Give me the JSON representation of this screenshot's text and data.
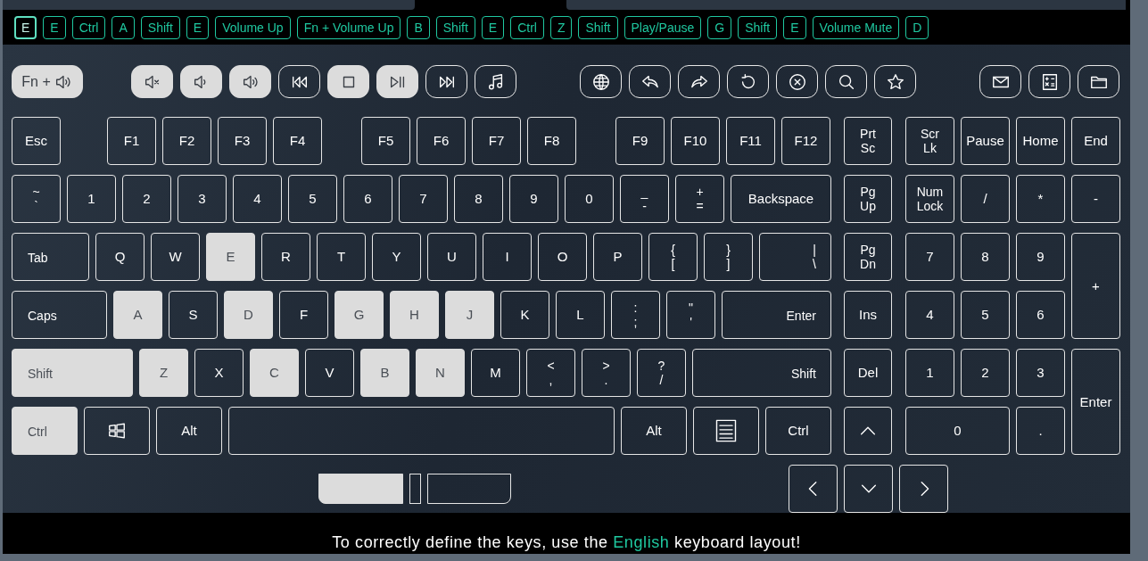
{
  "key_history": [
    {
      "label": "E",
      "selected": true
    },
    {
      "label": "E",
      "selected": false
    },
    {
      "label": "Ctrl",
      "selected": false
    },
    {
      "label": "A",
      "selected": false
    },
    {
      "label": "Shift",
      "selected": false
    },
    {
      "label": "E",
      "selected": false
    },
    {
      "label": "Volume Up",
      "selected": false
    },
    {
      "label": "Fn + Volume Up",
      "selected": false
    },
    {
      "label": "B",
      "selected": false
    },
    {
      "label": "Shift",
      "selected": false
    },
    {
      "label": "E",
      "selected": false
    },
    {
      "label": "Ctrl",
      "selected": false
    },
    {
      "label": "Z",
      "selected": false
    },
    {
      "label": "Shift",
      "selected": false
    },
    {
      "label": "Play/Pause",
      "selected": false
    },
    {
      "label": "G",
      "selected": false
    },
    {
      "label": "Shift",
      "selected": false
    },
    {
      "label": "E",
      "selected": false
    },
    {
      "label": "Volume Mute",
      "selected": false
    },
    {
      "label": "D",
      "selected": false
    }
  ],
  "media_keys": [
    {
      "kind": "fn-volume",
      "label": "Fn +",
      "pressed": true
    },
    {
      "kind": "mute",
      "pressed": true
    },
    {
      "kind": "volume-down",
      "pressed": true
    },
    {
      "kind": "volume-up",
      "pressed": true
    },
    {
      "kind": "previous",
      "pressed": false
    },
    {
      "kind": "stop",
      "pressed": true
    },
    {
      "kind": "play-pause",
      "pressed": true
    },
    {
      "kind": "next",
      "pressed": false
    },
    {
      "kind": "music",
      "pressed": false
    },
    {
      "kind": "globe",
      "pressed": false
    },
    {
      "kind": "back",
      "pressed": false
    },
    {
      "kind": "forward",
      "pressed": false
    },
    {
      "kind": "refresh",
      "pressed": false
    },
    {
      "kind": "cancel",
      "pressed": false
    },
    {
      "kind": "search",
      "pressed": false
    },
    {
      "kind": "star",
      "pressed": false
    },
    {
      "kind": "mail",
      "pressed": false
    },
    {
      "kind": "calculator",
      "pressed": false
    },
    {
      "kind": "folder",
      "pressed": false
    }
  ],
  "main_rows": [
    [
      {
        "lines": [
          "Esc"
        ],
        "pressed": false
      },
      {
        "lines": [
          "F1"
        ],
        "pressed": false
      },
      {
        "lines": [
          "F2"
        ],
        "pressed": false
      },
      {
        "lines": [
          "F3"
        ],
        "pressed": false
      },
      {
        "lines": [
          "F4"
        ],
        "pressed": false
      },
      {
        "lines": [
          "F5"
        ],
        "pressed": false
      },
      {
        "lines": [
          "F6"
        ],
        "pressed": false
      },
      {
        "lines": [
          "F7"
        ],
        "pressed": false
      },
      {
        "lines": [
          "F8"
        ],
        "pressed": false
      },
      {
        "lines": [
          "F9"
        ],
        "pressed": false
      },
      {
        "lines": [
          "F10"
        ],
        "pressed": false
      },
      {
        "lines": [
          "F11"
        ],
        "pressed": false
      },
      {
        "lines": [
          "F12"
        ],
        "pressed": false
      }
    ],
    [
      {
        "lines": [
          "~",
          "`"
        ],
        "pressed": false
      },
      {
        "lines": [
          "1"
        ],
        "pressed": false
      },
      {
        "lines": [
          "2"
        ],
        "pressed": false
      },
      {
        "lines": [
          "3"
        ],
        "pressed": false
      },
      {
        "lines": [
          "4"
        ],
        "pressed": false
      },
      {
        "lines": [
          "5"
        ],
        "pressed": false
      },
      {
        "lines": [
          "6"
        ],
        "pressed": false
      },
      {
        "lines": [
          "7"
        ],
        "pressed": false
      },
      {
        "lines": [
          "8"
        ],
        "pressed": false
      },
      {
        "lines": [
          "9"
        ],
        "pressed": false
      },
      {
        "lines": [
          "0"
        ],
        "pressed": false
      },
      {
        "lines": [
          "_",
          "-"
        ],
        "pressed": false
      },
      {
        "lines": [
          "+",
          "="
        ],
        "pressed": false
      },
      {
        "lines": [
          "Backspace"
        ],
        "pressed": false
      }
    ],
    [
      {
        "lines": [
          "Tab"
        ],
        "pressed": false
      },
      {
        "lines": [
          "Q"
        ],
        "pressed": false
      },
      {
        "lines": [
          "W"
        ],
        "pressed": false
      },
      {
        "lines": [
          "E"
        ],
        "pressed": true
      },
      {
        "lines": [
          "R"
        ],
        "pressed": false
      },
      {
        "lines": [
          "T"
        ],
        "pressed": false
      },
      {
        "lines": [
          "Y"
        ],
        "pressed": false
      },
      {
        "lines": [
          "U"
        ],
        "pressed": false
      },
      {
        "lines": [
          "I"
        ],
        "pressed": false
      },
      {
        "lines": [
          "O"
        ],
        "pressed": false
      },
      {
        "lines": [
          "P"
        ],
        "pressed": false
      },
      {
        "lines": [
          "{",
          "["
        ],
        "pressed": false
      },
      {
        "lines": [
          "}",
          "]"
        ],
        "pressed": false
      },
      {
        "lines": [
          "|",
          "\\"
        ],
        "pressed": false
      }
    ],
    [
      {
        "lines": [
          "Caps"
        ],
        "pressed": false
      },
      {
        "lines": [
          "A"
        ],
        "pressed": true
      },
      {
        "lines": [
          "S"
        ],
        "pressed": false
      },
      {
        "lines": [
          "D"
        ],
        "pressed": true
      },
      {
        "lines": [
          "F"
        ],
        "pressed": false
      },
      {
        "lines": [
          "G"
        ],
        "pressed": true
      },
      {
        "lines": [
          "H"
        ],
        "pressed": true
      },
      {
        "lines": [
          "J"
        ],
        "pressed": true
      },
      {
        "lines": [
          "K"
        ],
        "pressed": false
      },
      {
        "lines": [
          "L"
        ],
        "pressed": false
      },
      {
        "lines": [
          ":",
          ";"
        ],
        "pressed": false
      },
      {
        "lines": [
          "\"",
          "'"
        ],
        "pressed": false
      },
      {
        "lines": [
          "Enter"
        ],
        "pressed": false
      }
    ],
    [
      {
        "lines": [
          "Shift"
        ],
        "pressed": true
      },
      {
        "lines": [
          "Z"
        ],
        "pressed": true
      },
      {
        "lines": [
          "X"
        ],
        "pressed": false
      },
      {
        "lines": [
          "C"
        ],
        "pressed": true
      },
      {
        "lines": [
          "V"
        ],
        "pressed": false
      },
      {
        "lines": [
          "B"
        ],
        "pressed": true
      },
      {
        "lines": [
          "N"
        ],
        "pressed": true
      },
      {
        "lines": [
          "M"
        ],
        "pressed": false
      },
      {
        "lines": [
          "<",
          ","
        ],
        "pressed": false
      },
      {
        "lines": [
          ">",
          "."
        ],
        "pressed": false
      },
      {
        "lines": [
          "?",
          "/"
        ],
        "pressed": false
      },
      {
        "lines": [
          "Shift"
        ],
        "pressed": false
      }
    ],
    [
      {
        "lines": [
          "Ctrl"
        ],
        "pressed": true
      },
      {
        "kind": "windows",
        "pressed": false
      },
      {
        "lines": [
          "Alt"
        ],
        "pressed": false
      },
      {
        "kind": "space",
        "pressed": false
      },
      {
        "lines": [
          "Alt"
        ],
        "pressed": false
      },
      {
        "kind": "menu",
        "pressed": false
      },
      {
        "lines": [
          "Ctrl"
        ],
        "pressed": false
      }
    ]
  ],
  "nav_keys": [
    {
      "lines": [
        "Prt",
        "Sc"
      ],
      "pressed": false
    },
    {
      "lines": [
        "Pg",
        "Up"
      ],
      "pressed": false
    },
    {
      "lines": [
        "Pg",
        "Dn"
      ],
      "pressed": false
    },
    {
      "lines": [
        "Ins"
      ],
      "pressed": false
    },
    {
      "lines": [
        "Del"
      ],
      "pressed": false
    },
    {
      "kind": "up",
      "pressed": false
    }
  ],
  "numpad": [
    {
      "lines": [
        "Scr",
        "Lk"
      ],
      "pressed": false
    },
    {
      "lines": [
        "Pause"
      ],
      "pressed": false
    },
    {
      "lines": [
        "Home"
      ],
      "pressed": false
    },
    {
      "lines": [
        "End"
      ],
      "pressed": false
    },
    {
      "lines": [
        "Num",
        "Lock"
      ],
      "pressed": false
    },
    {
      "lines": [
        "/"
      ],
      "pressed": false
    },
    {
      "lines": [
        "*"
      ],
      "pressed": false
    },
    {
      "lines": [
        "-"
      ],
      "pressed": false
    },
    {
      "lines": [
        "7"
      ],
      "pressed": false
    },
    {
      "lines": [
        "8"
      ],
      "pressed": false
    },
    {
      "lines": [
        "9"
      ],
      "pressed": false
    },
    {
      "lines": [
        "+"
      ],
      "pressed": false
    },
    {
      "lines": [
        "4"
      ],
      "pressed": false
    },
    {
      "lines": [
        "5"
      ],
      "pressed": false
    },
    {
      "lines": [
        "6"
      ],
      "pressed": false
    },
    {
      "lines": [
        "1"
      ],
      "pressed": false
    },
    {
      "lines": [
        "2"
      ],
      "pressed": false
    },
    {
      "lines": [
        "3"
      ],
      "pressed": false
    },
    {
      "lines": [
        "Enter"
      ],
      "pressed": false
    },
    {
      "lines": [
        "0"
      ],
      "pressed": false
    },
    {
      "lines": [
        "."
      ],
      "pressed": false
    }
  ],
  "mouse_buttons": [
    {
      "pressed": true
    },
    {
      "pressed": false
    },
    {
      "pressed": false
    }
  ],
  "arrow_keys": [
    {
      "kind": "left",
      "pressed": false
    },
    {
      "kind": "down",
      "pressed": false
    },
    {
      "kind": "right",
      "pressed": false
    }
  ],
  "notice": {
    "before": "To correctly define the keys, use the",
    "highlight": "English",
    "after": "keyboard layout!"
  }
}
